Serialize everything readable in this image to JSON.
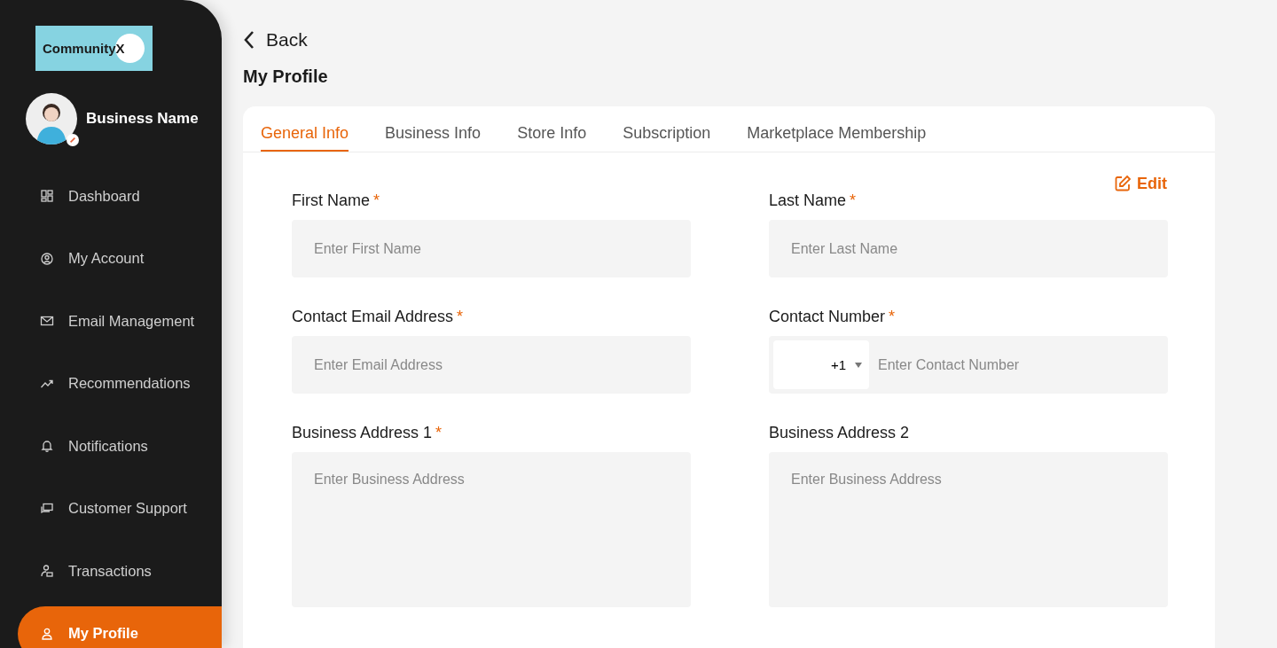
{
  "sidebar": {
    "logo": "CommunityX",
    "profile": {
      "name": "Business Name"
    },
    "items": [
      {
        "label": "Dashboard",
        "kind": "grid",
        "selected": false
      },
      {
        "label": "My Account",
        "kind": "account",
        "selected": false
      },
      {
        "label": "Email Management",
        "kind": "mail",
        "selected": false
      },
      {
        "label": "Recommendations",
        "kind": "trend",
        "selected": false
      },
      {
        "label": "Notifications",
        "kind": "bell",
        "selected": false
      },
      {
        "label": "Customer Support",
        "kind": "chat",
        "selected": false
      },
      {
        "label": "Transactions",
        "kind": "txn",
        "selected": false
      },
      {
        "label": "My Profile",
        "kind": "person",
        "selected": true
      }
    ]
  },
  "back": "Back",
  "title": "My Profile",
  "tabs": [
    {
      "label": "General Info",
      "selected": true
    },
    {
      "label": "Business Info",
      "selected": false
    },
    {
      "label": "Store Info",
      "selected": false
    },
    {
      "label": "Subscription",
      "selected": false
    },
    {
      "label": "Marketplace Membership",
      "selected": false
    }
  ],
  "edit": "Edit",
  "fields": [
    {
      "kind": "text",
      "label": "First Name",
      "required_mark": "*",
      "placeholder": "Enter First Name"
    },
    {
      "kind": "text",
      "label": "Last Name",
      "required_mark": "*",
      "placeholder": "Enter Last Name"
    },
    {
      "kind": "text",
      "label": "Contact Email Address",
      "required_mark": "*",
      "placeholder": "Enter Email Address"
    },
    {
      "kind": "phone",
      "label": "Contact Number",
      "required_mark": "*",
      "code": "+1",
      "placeholder": "Enter Contact Number"
    },
    {
      "kind": "textarea",
      "label": "Business Address 1",
      "required_mark": "*",
      "placeholder": "Enter Business Address"
    },
    {
      "kind": "textarea",
      "label": "Business Address 2",
      "placeholder": "Enter Business Address"
    }
  ]
}
